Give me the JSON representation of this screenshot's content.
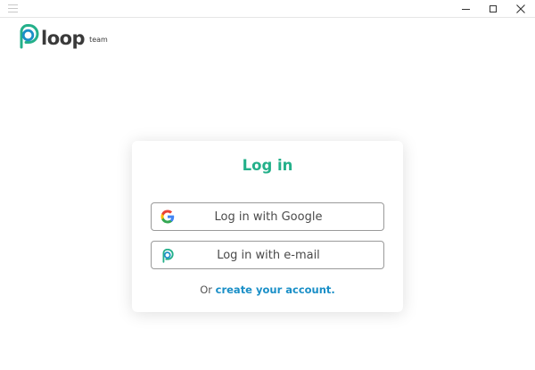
{
  "window": {
    "menu_icon": "hamburger-menu-icon",
    "controls": [
      "minimize-icon",
      "maximize-icon",
      "close-icon"
    ]
  },
  "brand": {
    "name": "loop",
    "suffix": "team",
    "colors": {
      "teal": "#24b08a",
      "blue": "#1a8fc7",
      "text": "#3a3a3a"
    }
  },
  "login": {
    "title": "Log in",
    "google_button": {
      "label": "Log in with Google",
      "icon": "google-icon"
    },
    "email_button": {
      "label": "Log in with e-mail",
      "icon": "loop-icon"
    },
    "footer_prefix": "Or",
    "footer_link": "create your account."
  }
}
